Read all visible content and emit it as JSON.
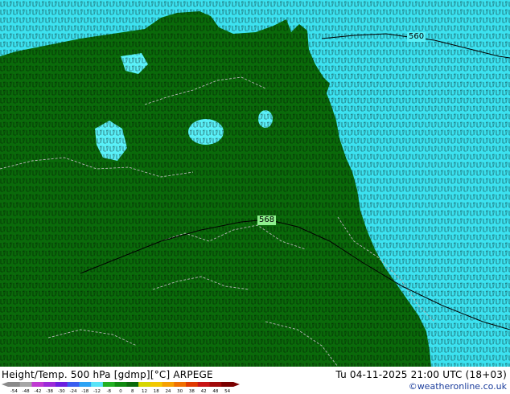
{
  "map": {
    "contour_labels": [
      "560",
      "568"
    ],
    "land_color": "#0a6a0a",
    "water_color": "#59f0f8",
    "sea_color": "#3ce2f0"
  },
  "footer": {
    "title": "Height/Temp. 500 hPa [gdmp][°C] ARPEGE",
    "datetime": "Tu 04-11-2025 21:00 UTC (18+03)",
    "credit": "©weatheronline.co.uk"
  },
  "colorbar": {
    "ticks": [
      "-54",
      "-48",
      "-42",
      "-38",
      "-30",
      "-24",
      "-18",
      "-12",
      "-8",
      "0",
      "8",
      "12",
      "18",
      "24",
      "30",
      "38",
      "42",
      "48",
      "54"
    ],
    "colors": [
      "#8a8a8a",
      "#a6a6a6",
      "#c03bd2",
      "#9c2bd8",
      "#6c1fe0",
      "#3a5ef0",
      "#2ca2f4",
      "#58e4f8",
      "#22b022",
      "#0f8a0f",
      "#0a6a0a",
      "#d6d600",
      "#f2c800",
      "#f6a000",
      "#f07000",
      "#e03a00",
      "#c81414",
      "#a00a0a",
      "#7a0000"
    ]
  }
}
